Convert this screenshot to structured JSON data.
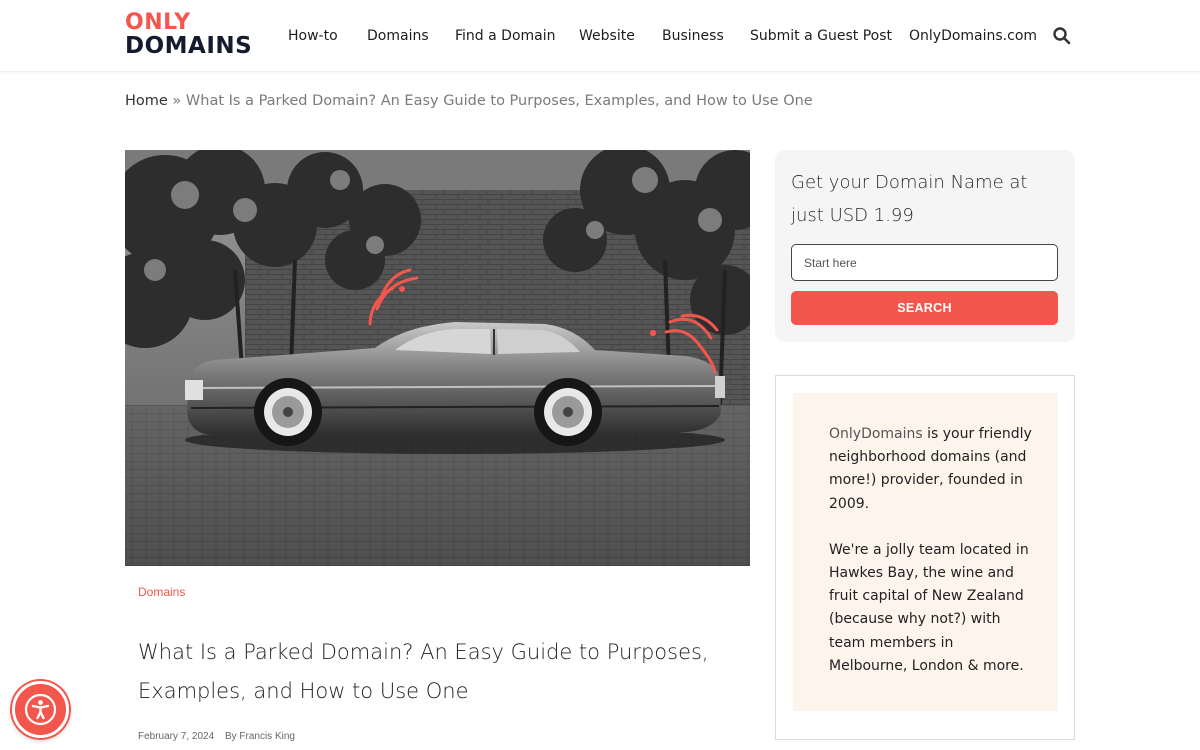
{
  "header": {
    "logo_line1": "ONLY",
    "logo_line2": "DOMAINS",
    "nav": [
      "How-to",
      "Domains",
      "Find a Domain",
      "Website",
      "Business",
      "Submit a Guest Post",
      "OnlyDomains.com"
    ],
    "search_icon": "search-icon"
  },
  "breadcrumb": {
    "home": "Home",
    "separator": " » ",
    "current": "What Is a Parked Domain? An Easy Guide to Purposes, Examples, and How to Use One"
  },
  "post": {
    "category": "Domains",
    "title": "What Is a Parked Domain? An Easy Guide to Purposes, Examples, and How to Use One",
    "date": "February 7, 2024",
    "author": "By Francis King"
  },
  "sidebar": {
    "search_widget": {
      "title": "Get your Domain Name at just USD 1.99",
      "input_placeholder": "Start here",
      "button_label": "SEARCH"
    },
    "about_widget": {
      "brand": "OnlyDomains",
      "p1_rest": " is your friendly neighborhood domains (and more!) provider, founded in 2009.",
      "p2": "We're a jolly team located in Hawkes Bay, the wine and fruit capital of New Zealand (because why not?) with team members in Melbourne, London & more."
    }
  },
  "accessibility_button": "accessibility-icon",
  "colors": {
    "accent": "#f2564c",
    "logo_dark": "#151b2e",
    "search_widget_bg": "#f5f5f5",
    "about_box_bg": "#fdf4ec"
  }
}
